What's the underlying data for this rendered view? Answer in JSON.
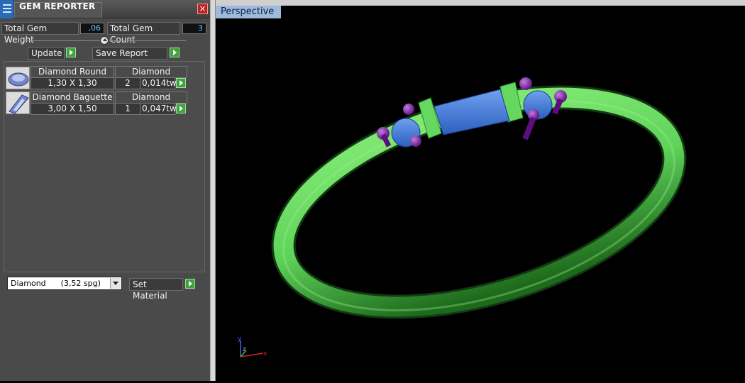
{
  "panel": {
    "title": "GEM REPORTER",
    "close_symbol": "×",
    "total_weight_label": "Total Gem Weight",
    "total_weight_value": ",06",
    "total_count_label": "Total Gem Count",
    "total_count_value": "3",
    "update_label": "Update",
    "save_report_label": "Save Report",
    "gems": [
      {
        "icon": "round-diamond-icon",
        "name": "Diamond Round",
        "material": "Diamond",
        "size": "1,30 X 1,30",
        "count": "2",
        "weight": "0,014tw"
      },
      {
        "icon": "baguette-diamond-icon",
        "name": "Diamond Baguette",
        "material": "Diamond",
        "size": "3,00 X 1,50",
        "count": "1",
        "weight": "0,047tw"
      }
    ],
    "material_select_value": "Diamond      (3,52 spg)",
    "set_material_label": "Set Material"
  },
  "viewport": {
    "label": "Perspective",
    "axis_y": "y",
    "axis_z": "z",
    "axis_x": "x"
  },
  "colors": {
    "ring_green": "#5fd35a",
    "gem_blue": "#3f78d8",
    "prong_purple": "#7a1fa0",
    "panel_bg": "#4a4a4a"
  }
}
